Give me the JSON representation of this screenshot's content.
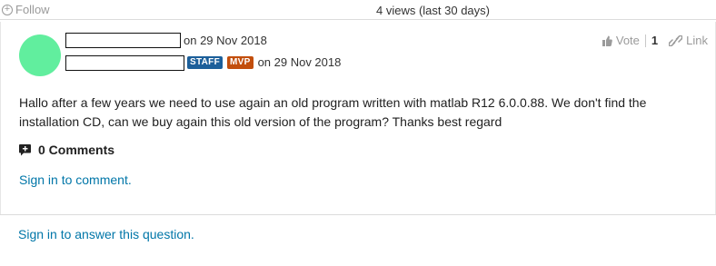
{
  "header": {
    "follow_label": "Follow",
    "views_text": "4 views (last 30 days)"
  },
  "post": {
    "avatar_color": "#61ee9e",
    "asked_date": "on 29 Nov 2018",
    "badges": {
      "staff": "STAFF",
      "mvp": "MVP"
    },
    "edited_date": "on 29 Nov 2018",
    "vote_label": "Vote",
    "vote_count": "1",
    "link_label": "Link",
    "body": "Hallo after a few years we need to use again an old program written with matlab R12 6.0.0.88. We don't find the installation CD, can we buy again this old version of the program? Thanks best regard"
  },
  "comments": {
    "label": "0 Comments",
    "signin_text": "Sign in to comment."
  },
  "answer": {
    "signin_text": "Sign in to answer this question."
  },
  "colors": {
    "link": "#0076a8",
    "staff_badge": "#1c5f9a",
    "mvp_badge": "#c24e0c"
  }
}
